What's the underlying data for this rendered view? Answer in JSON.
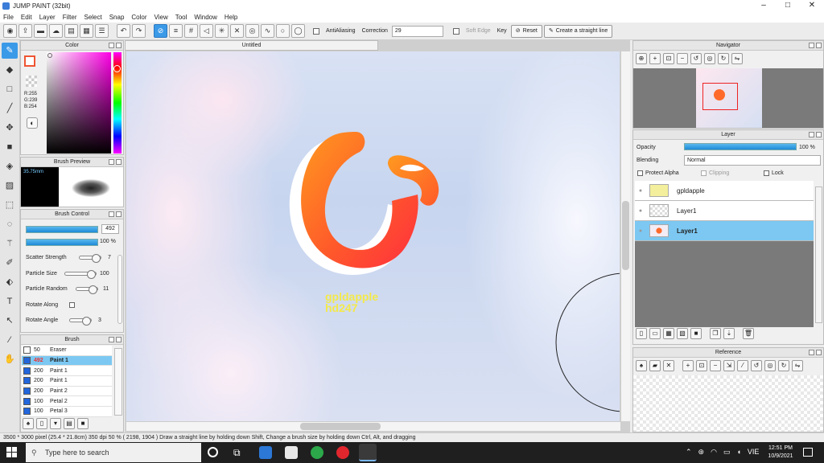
{
  "window": {
    "title": "JUMP PAINT (32bit)",
    "minimize": "–",
    "maximize": "□",
    "close": "✕"
  },
  "menu": [
    "File",
    "Edit",
    "Layer",
    "Filter",
    "Select",
    "Snap",
    "Color",
    "View",
    "Tool",
    "Window",
    "Help"
  ],
  "toolbar": {
    "antialiasing_label": "AntiAliasing",
    "correction_label": "Correction",
    "correction_value": "29",
    "soft_edge_label": "Soft Edge",
    "key_label": "Key",
    "reset_label": "Reset",
    "straight_line_label": "Create a straight line"
  },
  "color_panel": {
    "title": "Color",
    "rgb": [
      "R:255",
      "G:239",
      "B:254"
    ]
  },
  "brush_preview": {
    "title": "Brush Preview",
    "size": "35.75mm"
  },
  "brush_control": {
    "title": "Brush Control",
    "size_value": "492",
    "opacity_value": "100 %",
    "rows": [
      {
        "label": "Scatter Strength",
        "value": "7"
      },
      {
        "label": "Particle Size",
        "value": "100"
      },
      {
        "label": "Particle Random",
        "value": "11"
      },
      {
        "label": "Rotate Along",
        "value": ""
      },
      {
        "label": "Rotate Angle",
        "value": "3"
      }
    ]
  },
  "brush_list": {
    "title": "Brush",
    "items": [
      {
        "size": "50",
        "name": "Eraser",
        "color": "#ffffff"
      },
      {
        "size": "492",
        "name": "Paint 1",
        "color": "#2266dd"
      },
      {
        "size": "200",
        "name": "Paint 1",
        "color": "#2266dd"
      },
      {
        "size": "200",
        "name": "Paint 1",
        "color": "#2266dd"
      },
      {
        "size": "200",
        "name": "Paint 2",
        "color": "#2266dd"
      },
      {
        "size": "100",
        "name": "Petal 2",
        "color": "#2266dd"
      },
      {
        "size": "100",
        "name": "Petal 3",
        "color": "#2266dd"
      }
    ]
  },
  "canvas": {
    "tab_title": "Untitled",
    "watermark_line1": "gpldapple",
    "watermark_line2": "hd247"
  },
  "navigator": {
    "title": "Navigator"
  },
  "layer_panel": {
    "title": "Layer",
    "opacity_label": "Opacity",
    "opacity_value": "100 %",
    "blending_label": "Blending",
    "blending_value": "Normal",
    "protect_alpha": "Protect Alpha",
    "clipping": "Clipping",
    "lock": "Lock",
    "layers": [
      "gpldapple",
      "Layer1",
      "Layer1"
    ]
  },
  "reference": {
    "title": "Reference"
  },
  "status": "3500 * 3000 pixel   (25.4 * 21.8cm)   350 dpi   50 %   ( 2198, 1904 )   Draw a straight line by holding down Shift, Change a brush size by holding down Ctrl, Alt, and dragging",
  "taskbar": {
    "search_placeholder": "Type here to search",
    "time": "12:51 PM",
    "date": "10/9/2021",
    "lang": "VIE"
  },
  "colors": {
    "accent": "#3b9ae8",
    "selected_row": "#7cc8f2",
    "logo_orange": "#ff8a1f",
    "logo_red": "#ff3b3b"
  }
}
